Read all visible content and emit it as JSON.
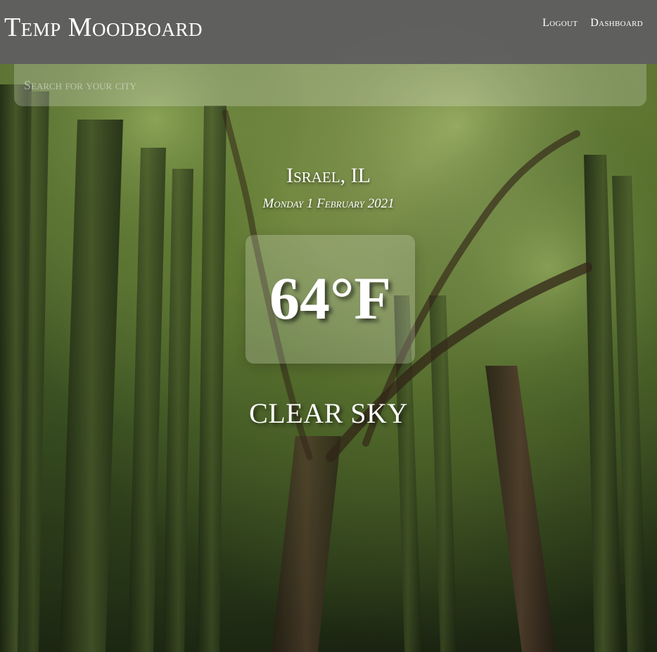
{
  "header": {
    "brand": "Temp Moodboard",
    "nav": {
      "logout": "Logout",
      "dashboard": "Dashboard"
    }
  },
  "search": {
    "placeholder": "Search for your city",
    "value": ""
  },
  "weather": {
    "location": "Israel, IL",
    "date": "Monday 1 February 2021",
    "temperature": "64°F",
    "condition": "CLEAR SKY"
  },
  "background": {
    "scene": "bamboo forest photo"
  },
  "colors": {
    "header_bg": "#5f5f5f",
    "text": "#ffffff"
  }
}
